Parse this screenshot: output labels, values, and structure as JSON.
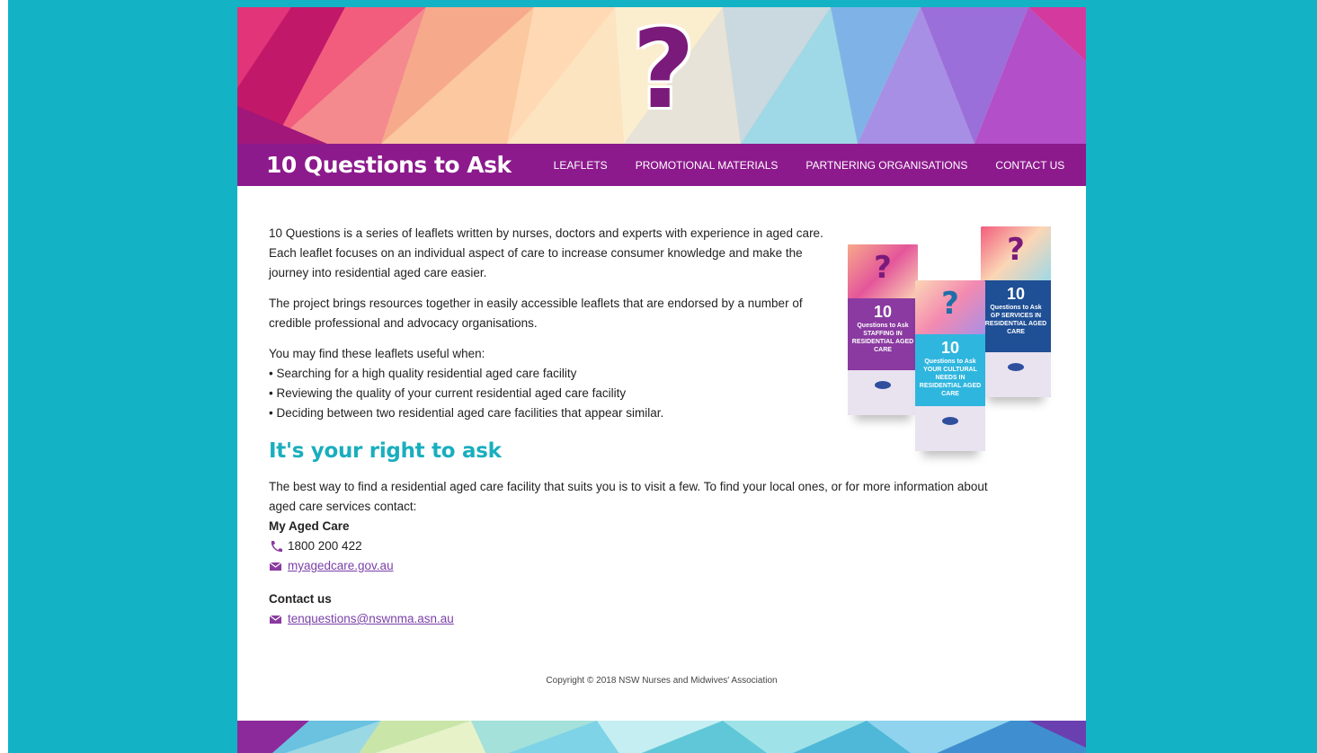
{
  "site": {
    "title": "10 Questions to Ask",
    "banner_glyph": "?"
  },
  "nav": {
    "items": [
      "LEAFLETS",
      "PROMOTIONAL MATERIALS",
      "PARTNERING ORGANISATIONS",
      "CONTACT US"
    ]
  },
  "intro": {
    "p1": "10 Questions is a series of leaflets written by nurses, doctors and experts with experience in aged care. Each leaflet focuses on an individual aspect of care to increase consumer knowledge and make the journey into residential aged care easier.",
    "p2": "The project brings resources together in easily accessible leaflets that are endorsed by a number of credible professional and advocacy organisations.",
    "uses_heading": "You may find these leaflets useful when:",
    "uses": [
      "• Searching for a high quality residential aged care facility",
      "• Reviewing the quality of your current residential aged care facility",
      "• Deciding between two residential aged care facilities that appear similar."
    ]
  },
  "right": {
    "heading": "It's your right to ask",
    "body": "The best way to find a residential aged care facility that suits you is to visit a few. To find your local ones, or for more information about aged care services contact:"
  },
  "my_aged_care": {
    "name": "My Aged Care",
    "phone": "1800 200 422",
    "website": "myagedcare.gov.au"
  },
  "contact": {
    "heading": "Contact us",
    "email": "tenquestions@nswnma.asn.au"
  },
  "leaflets": [
    {
      "number": "10",
      "subtitle": "Questions to Ask",
      "topic": "STAFFING IN RESIDENTIAL AGED CARE",
      "color": "#8a3aa0"
    },
    {
      "number": "10",
      "subtitle": "Questions to Ask",
      "topic": "YOUR CULTURAL NEEDS IN RESIDENTIAL AGED CARE",
      "color": "#2fb6df"
    },
    {
      "number": "10",
      "subtitle": "Questions to Ask",
      "topic": "GP SERVICES IN RESIDENTIAL AGED CARE",
      "color": "#1f4f95"
    }
  ],
  "footer": {
    "copyright": "Copyright © 2018 NSW Nurses and Midwives' Association"
  },
  "colors": {
    "page_background": "#13b3c5",
    "navbar": "#8c1a8c",
    "heading_accent": "#19aebe",
    "link": "#7a3fa8",
    "question_mark": "#7a1a7a"
  },
  "icons": [
    "phone-icon",
    "envelope-icon"
  ]
}
